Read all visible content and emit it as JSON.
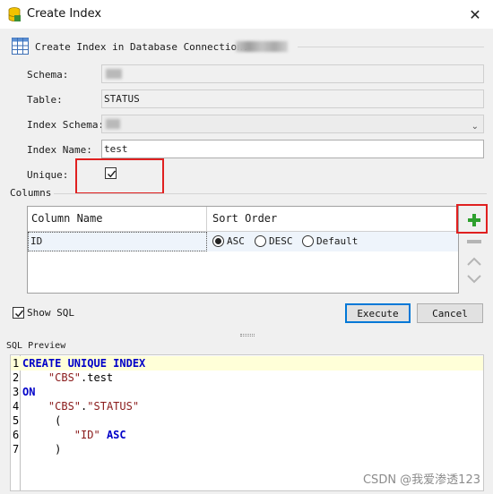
{
  "window": {
    "title": "Create Index"
  },
  "form": {
    "connection_label": "Create Index in Database Connection:",
    "schema_label": "Schema:",
    "table_label": "Table:",
    "table_value": "STATUS",
    "index_schema_label": "Index Schema:",
    "index_name_label": "Index Name:",
    "index_name_value": "test",
    "unique_label": "Unique:",
    "unique_checked": true
  },
  "columns": {
    "label": "Columns",
    "headers": [
      "Column Name",
      "Sort Order"
    ],
    "rows": [
      {
        "name": "ID",
        "sort": "ASC"
      }
    ],
    "sort_options": [
      "ASC",
      "DESC",
      "Default"
    ]
  },
  "footer": {
    "show_sql_label": "Show SQL",
    "show_sql_checked": true,
    "execute_label": "Execute",
    "cancel_label": "Cancel"
  },
  "sql_preview": {
    "label": "SQL Preview",
    "lines": [
      {
        "num": "1",
        "parts": [
          [
            "kw",
            "CREATE UNIQUE INDEX"
          ]
        ]
      },
      {
        "num": "2",
        "parts": [
          [
            "plain",
            "    "
          ],
          [
            "str",
            "\"CBS\""
          ],
          [
            "plain",
            ".test"
          ]
        ]
      },
      {
        "num": "3",
        "parts": [
          [
            "kw",
            "ON"
          ]
        ]
      },
      {
        "num": "4",
        "parts": [
          [
            "plain",
            "    "
          ],
          [
            "str",
            "\"CBS\""
          ],
          [
            "plain",
            "."
          ],
          [
            "str",
            "\"STATUS\""
          ]
        ]
      },
      {
        "num": "5",
        "parts": [
          [
            "plain",
            "     ("
          ]
        ]
      },
      {
        "num": "6",
        "parts": [
          [
            "plain",
            "        "
          ],
          [
            "str",
            "\"ID\""
          ],
          [
            "plain",
            " "
          ],
          [
            "kw",
            "ASC"
          ]
        ]
      },
      {
        "num": "7",
        "parts": [
          [
            "plain",
            "     )"
          ]
        ]
      }
    ]
  },
  "watermark": "CSDN @我爱渗透123",
  "colors": {
    "highlight_red": "#e02020",
    "keyword_blue": "#0000c8",
    "add_green": "#2ea02e"
  }
}
